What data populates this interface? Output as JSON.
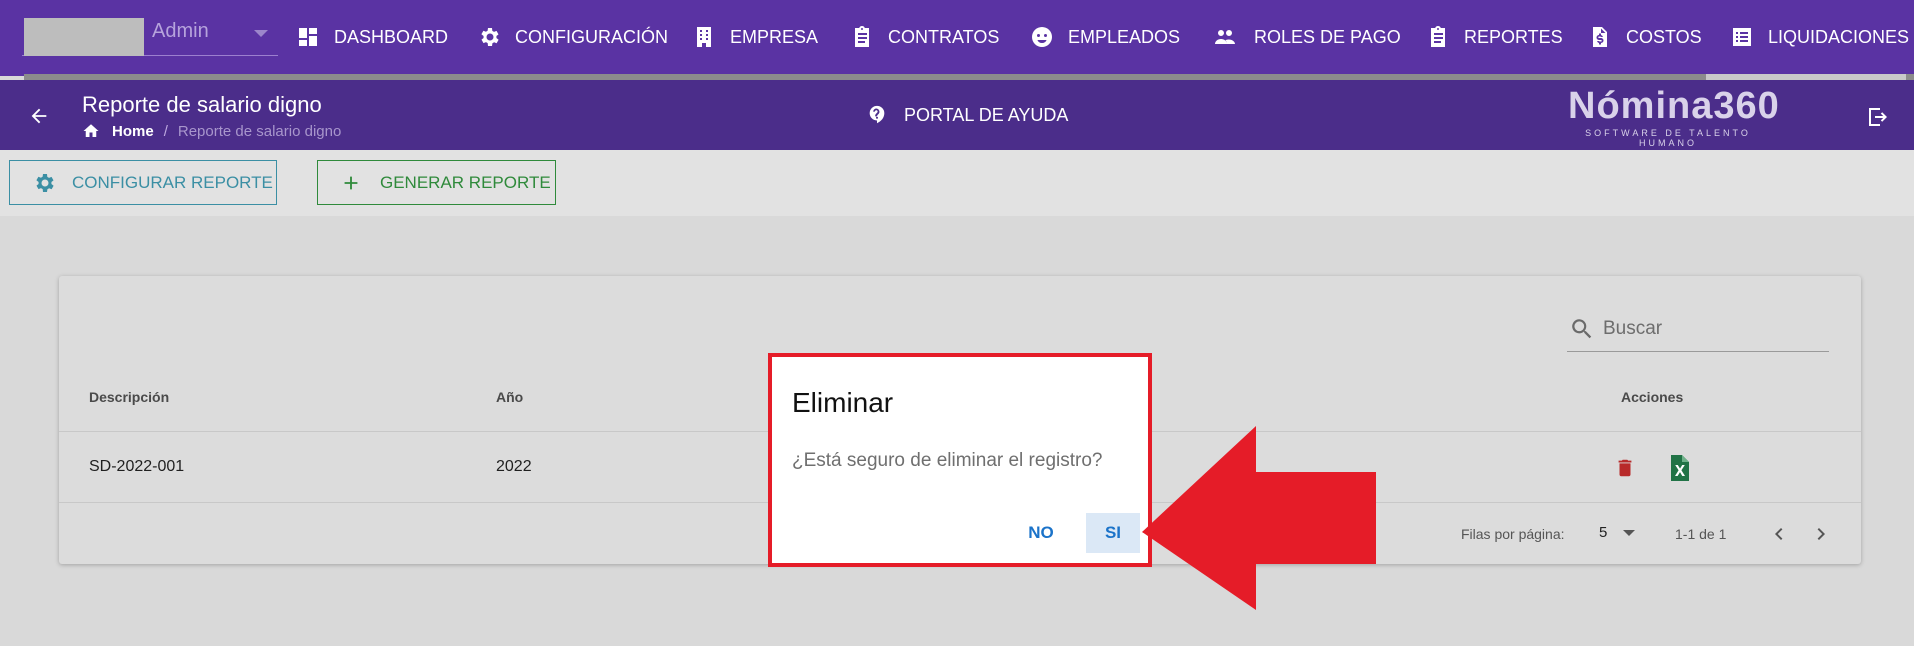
{
  "topnav": {
    "user": {
      "name": "Admin"
    },
    "items": [
      {
        "label": "DASHBOARD",
        "icon": "dashboard-icon"
      },
      {
        "label": "CONFIGURACIÓN",
        "icon": "gear-icon"
      },
      {
        "label": "EMPRESA",
        "icon": "building-icon"
      },
      {
        "label": "CONTRATOS",
        "icon": "clipboard-icon"
      },
      {
        "label": "EMPLEADOS",
        "icon": "face-icon"
      },
      {
        "label": "ROLES DE PAGO",
        "icon": "users-icon"
      },
      {
        "label": "REPORTES",
        "icon": "clipboard-icon"
      },
      {
        "label": "COSTOS",
        "icon": "file-dollar-icon"
      },
      {
        "label": "LIQUIDACIONES",
        "icon": "list-icon"
      }
    ]
  },
  "subheader": {
    "title": "Reporte de salario digno",
    "breadcrumb": {
      "home": "Home",
      "separator": "/",
      "current": "Reporte de salario digno"
    },
    "help": "PORTAL DE AYUDA",
    "logo": {
      "main": "Nómina360",
      "sub": "SOFTWARE DE TALENTO HUMANO"
    }
  },
  "toolbar": {
    "configure_label": "CONFIGURAR REPORTE",
    "generate_label": "GENERAR REPORTE"
  },
  "table": {
    "search_placeholder": "Buscar",
    "headers": {
      "description": "Descripción",
      "year": "Año",
      "actions": "Acciones"
    },
    "rows": [
      {
        "description": "SD-2022-001",
        "year": "2022"
      }
    ],
    "footer": {
      "rows_per_page_label": "Filas por página:",
      "rows_per_page": "5",
      "range": "1-1 de 1"
    }
  },
  "dialog": {
    "title": "Eliminar",
    "message": "¿Está seguro de eliminar el registro?",
    "no_label": "NO",
    "yes_label": "SI"
  },
  "colors": {
    "nav_bg": "#5a33a3",
    "subheader_bg": "#4b2d8a",
    "highlight_red": "#e51c28",
    "delete_red": "#b82a2a",
    "excel_green": "#217346",
    "link_blue": "#1b73c9"
  }
}
